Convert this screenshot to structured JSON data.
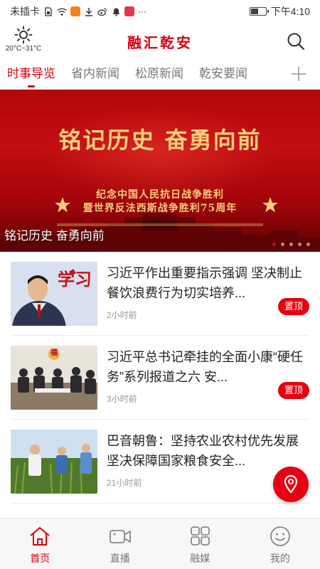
{
  "status_bar": {
    "carrier": "未插卡",
    "time": "下午4:10",
    "more": "···",
    "icons": [
      "sim-icon",
      "wifi-icon",
      "app-notify-icon",
      "download-icon",
      "weibo-icon",
      "bell-icon",
      "app-badge-icon"
    ],
    "battery_level": 0.55
  },
  "header": {
    "weather_temp": "20°C~31°C",
    "weather_icon": "sun-icon",
    "title": "融汇乾安",
    "search_icon": "search-icon",
    "brand_color": "#d7000f"
  },
  "tabs": {
    "items": [
      {
        "label": "时事导览",
        "active": true
      },
      {
        "label": "省内新闻",
        "active": false
      },
      {
        "label": "松原新闻",
        "active": false
      },
      {
        "label": "乾安要闻",
        "active": false
      }
    ],
    "more_icon": "plus-icon"
  },
  "banner": {
    "headline": "铭记历史  奋勇向前",
    "subline1": "纪念中国人民抗日战争胜利",
    "subline2": "暨世界反法西斯战争胜利75周年",
    "caption": "铭记历史  奋勇向前",
    "slide_count": 5,
    "active_slide": 1
  },
  "news": [
    {
      "title": "习近平作出重要指示强调 坚决制止餐饮浪费行为切实培养...",
      "time": "2小时前",
      "badge": "置顶",
      "thumb_text": "学习"
    },
    {
      "title": "习近平总书记牵挂的全面小康“硬任务”系列报道之六 安...",
      "time": "3小时前",
      "badge": "置顶",
      "thumb_text": "福"
    },
    {
      "title": "巴音朝鲁：坚持农业农村优先发展 坚决保障国家粮食安全...",
      "time": "21小时前",
      "badge": "",
      "thumb_text": ""
    }
  ],
  "fab": {
    "icon": "location-pin-icon"
  },
  "bottom_nav": [
    {
      "label": "首页",
      "icon": "home-icon",
      "active": true
    },
    {
      "label": "直播",
      "icon": "video-camera-icon",
      "active": false
    },
    {
      "label": "融媒",
      "icon": "grid-icon",
      "active": false
    },
    {
      "label": "我的",
      "icon": "smile-icon",
      "active": false
    }
  ]
}
